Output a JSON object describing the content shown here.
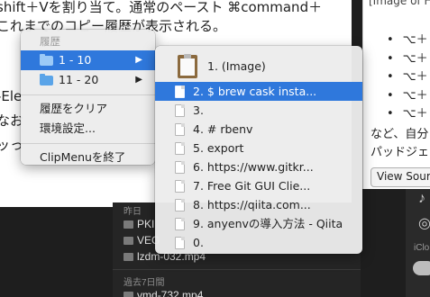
{
  "doc": {
    "lines": [
      "shift＋Vを割り当て。通常のペースト ⌘command＋",
      "これまでのコピー履歴が表示される。",
      "-Ele",
      "なお",
      "ッっ"
    ]
  },
  "right_doc": {
    "header": "[Image of H",
    "bullets": [
      "⌥＋",
      "⌥＋",
      "⌥＋",
      "⌥＋",
      "⌥＋"
    ],
    "para1": "など、自分",
    "para2": "パッドジェ",
    "view_source": "View Sourc"
  },
  "finder": {
    "section1": "昨日",
    "section2": "過去7日間",
    "files": [
      "PKI",
      "VEG",
      "lzdm-032.mp4",
      "vmd-732.mp4"
    ]
  },
  "right_strip": {
    "label": "iClo"
  },
  "clipmenu": {
    "header": "履歴",
    "folders": [
      {
        "label": "1 - 10",
        "icon": "folder-icon",
        "highlighted": true
      },
      {
        "label": "11 - 20",
        "icon": "folder-icon",
        "highlighted": false
      }
    ],
    "clear_history": "履歴をクリア",
    "preferences": "環境設定...",
    "quit": "ClipMenuを終了",
    "submenu_arrow": "▶"
  },
  "history_items": [
    {
      "label": "1. (Image)",
      "icon": "clipboard-icon",
      "highlighted": false
    },
    {
      "label": "2. $ brew cask insta...",
      "icon": "document-icon",
      "highlighted": true
    },
    {
      "label": "3.",
      "icon": "document-icon",
      "highlighted": false
    },
    {
      "label": "4. # rbenv",
      "icon": "document-icon",
      "highlighted": false
    },
    {
      "label": "5. export",
      "icon": "document-icon",
      "highlighted": false
    },
    {
      "label": "6. https://www.gitkr...",
      "icon": "document-icon",
      "highlighted": false
    },
    {
      "label": "7. Free Git GUI Clie...",
      "icon": "document-icon",
      "highlighted": false
    },
    {
      "label": "8. https://qiita.com...",
      "icon": "document-icon",
      "highlighted": false
    },
    {
      "label": "9. anyenvの導入方法 - Qiita",
      "icon": "document-icon",
      "highlighted": false
    },
    {
      "label": "0.",
      "icon": "document-icon",
      "highlighted": false
    }
  ],
  "colors": {
    "highlight": "#2f78dc",
    "menu_bg": "#ececec",
    "folder": "#5aa4e8"
  }
}
